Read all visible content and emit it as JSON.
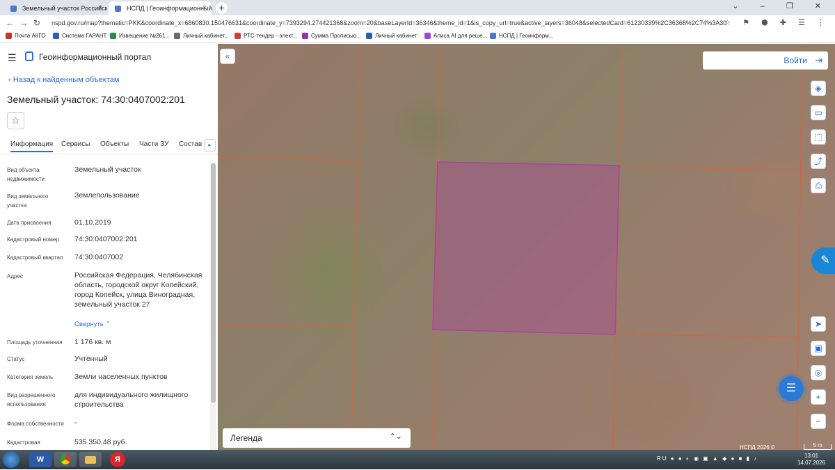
{
  "browser": {
    "tabs": [
      {
        "title": "Земельный участок Российская...",
        "close": "×"
      },
      {
        "title": "НСПД | Геоинформационный п...",
        "close": "×"
      }
    ],
    "new_tab": "+",
    "url": "nspd.gov.ru/map?thematic=PKK&coordinate_x=6860830.150476631&coordinate_y=7393294.274421368&zoom=20&baseLayerId=36346&theme_id=1&is_copy_url=true&active_layers=36048&selectedCard=61230339%2C36368%2C74%3A30...",
    "bookmarks": [
      {
        "label": "Почта АКГО",
        "color": "#d0302a"
      },
      {
        "label": "Система ГАРАНТ",
        "color": "#2a5fb0"
      },
      {
        "label": "Извещение №261...",
        "color": "#2a8a4a"
      },
      {
        "label": "Личный кабинет...",
        "color": "#6a6a6a"
      },
      {
        "label": "РТС-тендер - элект...",
        "color": "#d04030"
      },
      {
        "label": "Сумма Прописью...",
        "color": "#8a3ab0"
      },
      {
        "label": "Личный кабинет",
        "color": "#2a5fb0"
      },
      {
        "label": "Алиса AI для реше...",
        "color": "#9a4ad0"
      },
      {
        "label": "НСПД | Геоинформ...",
        "color": "#4a78d0"
      }
    ]
  },
  "panel": {
    "portal_title": "Геоинформационный портал",
    "back_link": "Назад к найденным объектам",
    "object_title": "Земельный участок: 74:30:0407002:201",
    "fav_icon": "☆",
    "tabs": [
      "Информация",
      "Сервисы",
      "Объекты",
      "Части ЗУ",
      "Состав"
    ],
    "tab_arrow": "▸",
    "attributes": [
      {
        "key": "Вид объекта недвижимости",
        "value": "Земельный участок"
      },
      {
        "key": "Вид земельного участка",
        "value": "Землепользование"
      },
      {
        "key": "Дата присвоения",
        "value": "01.10.2019"
      },
      {
        "key": "Кадастровый номер",
        "value": "74:30:0407002:201"
      },
      {
        "key": "Кадастровый квартал",
        "value": "74:30:0407002"
      },
      {
        "key": "Адрес",
        "value": "Российская Федерация, Челябинская область, городской округ Копейский, город Копейск, улица Виноградная, земельный участок 27"
      },
      {
        "key": "Площадь уточненная",
        "value": "1 176 кв. м"
      },
      {
        "key": "Статус",
        "value": "Учтенный"
      },
      {
        "key": "Категория земель",
        "value": "Земли населенных пунктов"
      },
      {
        "key": "Вид разрешенного использования",
        "value": "для индивидуального жилищного строительства"
      },
      {
        "key": "Форма собственности",
        "value": "-"
      },
      {
        "key": "Кадастровая стоимость",
        "value": "535 350,48 руб."
      }
    ],
    "collapse_link": "Свернуть ⌃"
  },
  "map": {
    "login_label": "Войти",
    "legend_label": "Легенда",
    "copyright": "НСПД 2026 ©",
    "scale_label": "5 m",
    "parcel_color": "#b040a0",
    "boundary_color": "#e0603a",
    "controls": {
      "collapse": "«",
      "zoom_in": "+",
      "zoom_out": "−"
    }
  },
  "taskbar": {
    "lang": "RU",
    "time": "13:01",
    "date": "14.07.2026",
    "apps": [
      "W",
      "",
      "",
      "Я"
    ]
  }
}
